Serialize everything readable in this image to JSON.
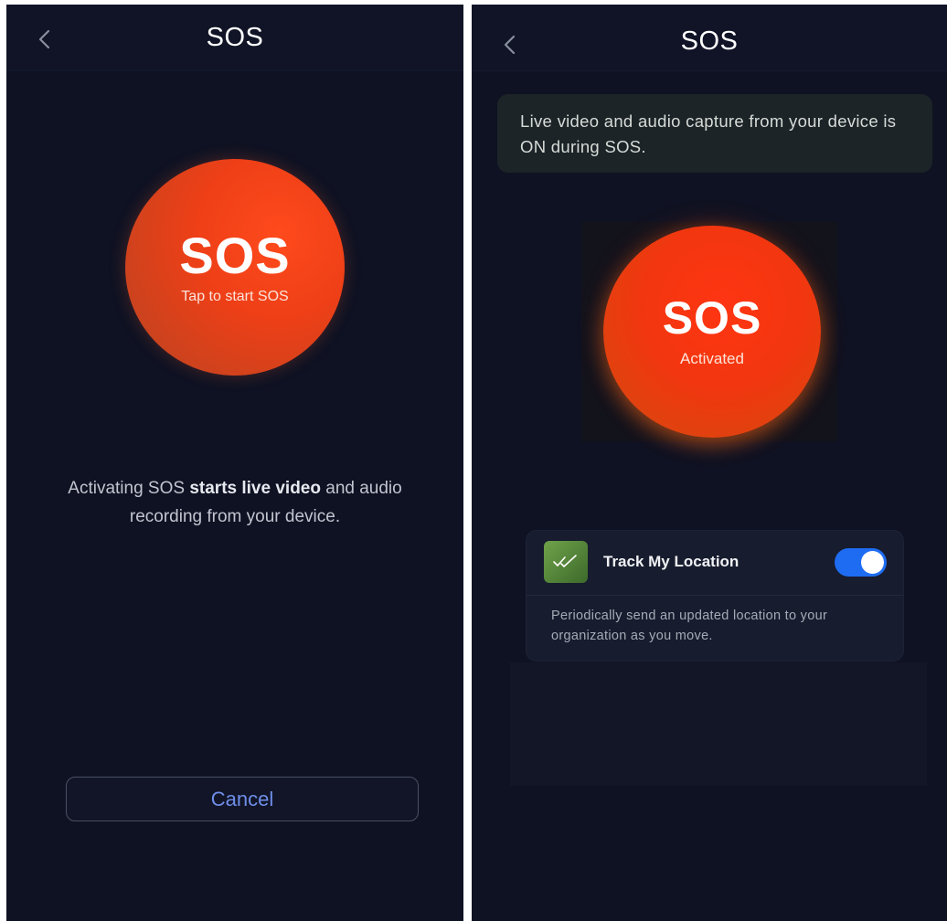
{
  "left_screen": {
    "title": "SOS",
    "sos_button": {
      "main": "SOS",
      "sub": "Tap to start SOS"
    },
    "info": {
      "prefix": "Activating SOS ",
      "bold": "starts live video",
      "suffix": " and audio recording from your device."
    },
    "cancel_label": "Cancel"
  },
  "right_screen": {
    "title": "SOS",
    "banner": "Live video and audio capture from your device is ON during SOS.",
    "sos_button": {
      "main": "SOS",
      "sub": "Activated"
    },
    "track": {
      "label": "Track My Location",
      "enabled": true,
      "description": "Periodically send an updated location to your organization as you move."
    }
  },
  "colors": {
    "background": "#0e1223",
    "sos_red": "#ef3e16",
    "accent_blue": "#1e6cf2",
    "cancel_text": "#6f8ee9"
  },
  "icons": {
    "back": "chevron-left-icon",
    "track": "double-check-icon"
  }
}
